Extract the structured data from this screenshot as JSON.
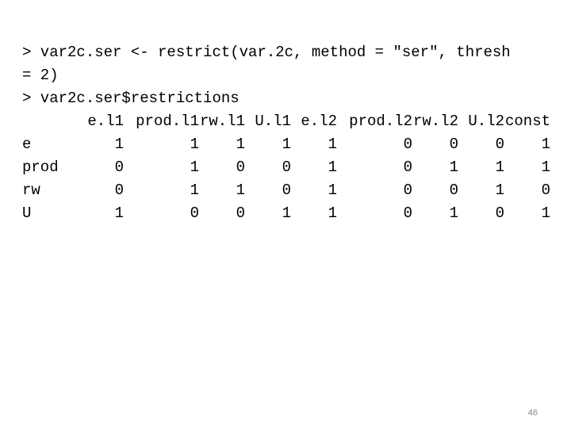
{
  "slide": {
    "page_number": "46",
    "background_color": "#ffffff",
    "text_color": "#000000",
    "page_number_color": "#8a8a8a"
  },
  "console": {
    "code_lines": [
      "> var2c.ser <- restrict(var.2c, method = \"ser\", thresh",
      "= 2)",
      "> var2c.ser$restrictions"
    ]
  },
  "restrictions_table": {
    "corner_label": "",
    "columns": [
      "e.l1",
      "prod.l1",
      "rw.l1",
      "U.l1",
      "e.l2",
      "prod.l2",
      "rw.l2",
      "U.l2",
      "const"
    ],
    "rows": [
      {
        "name": "e",
        "values": [
          "1",
          "1",
          "1",
          "1",
          "1",
          "0",
          "0",
          "0",
          "1"
        ]
      },
      {
        "name": "prod",
        "values": [
          "0",
          "1",
          "0",
          "0",
          "1",
          "0",
          "1",
          "1",
          "1"
        ]
      },
      {
        "name": "rw",
        "values": [
          "0",
          "1",
          "1",
          "0",
          "1",
          "0",
          "0",
          "1",
          "0"
        ]
      },
      {
        "name": "U",
        "values": [
          "1",
          "0",
          "0",
          "1",
          "1",
          "0",
          "1",
          "0",
          "1"
        ]
      }
    ]
  }
}
